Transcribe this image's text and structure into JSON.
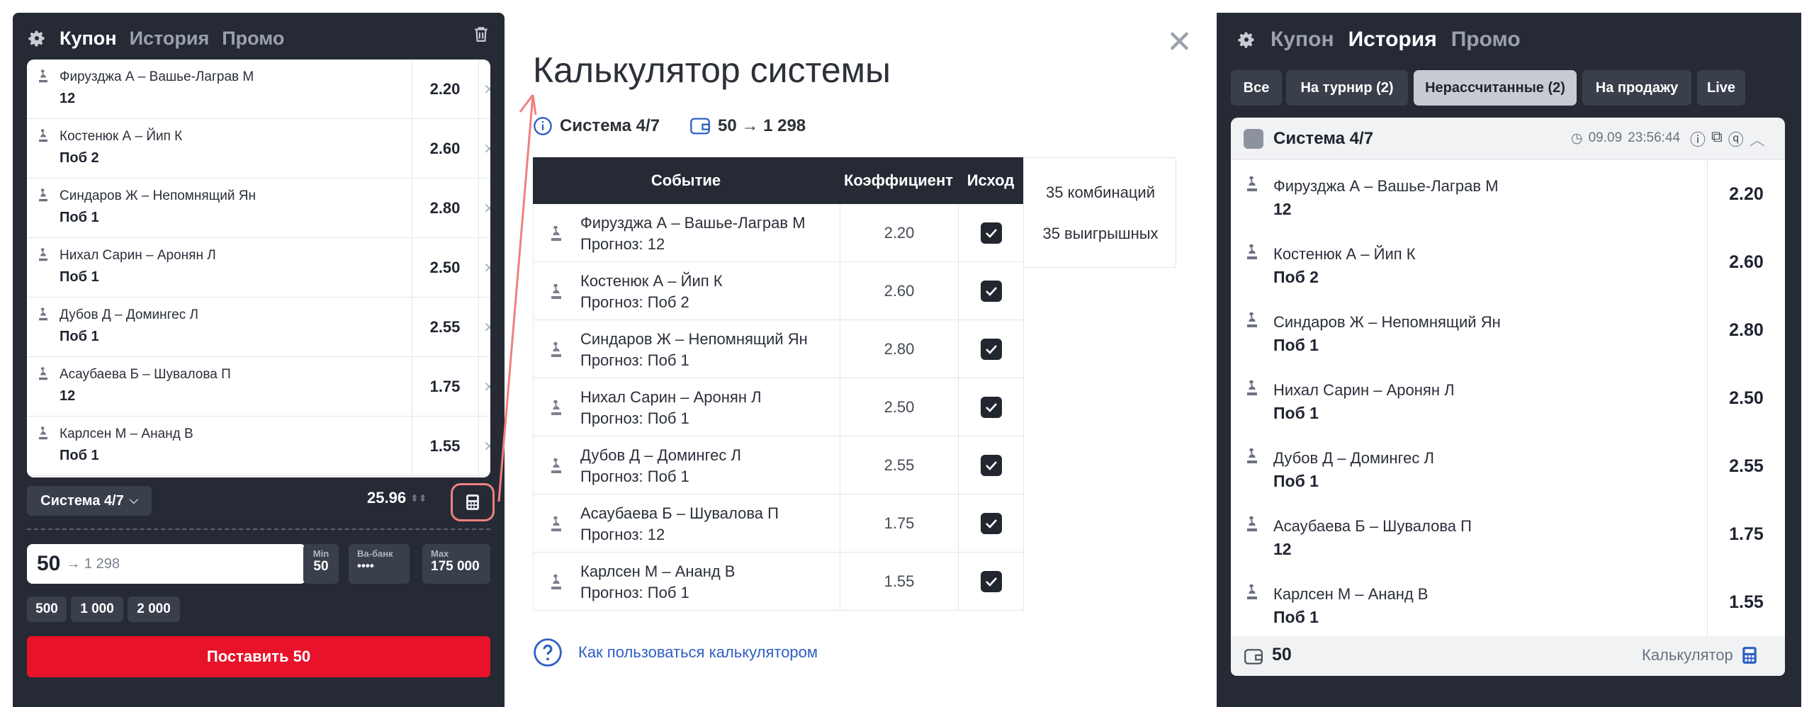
{
  "left": {
    "tabs": [
      "Купон",
      "История",
      "Промо"
    ],
    "events": [
      {
        "event": "Фирузджа А – Вашье-Лаграв М",
        "outcome": "12",
        "coef": "2.20"
      },
      {
        "event": "Костенюк А – Йип К",
        "outcome": "Поб 2",
        "coef": "2.60"
      },
      {
        "event": "Синдаров Ж – Непомнящий Ян",
        "outcome": "Поб 1",
        "coef": "2.80"
      },
      {
        "event": "Нихал Сарин – Аронян Л",
        "outcome": "Поб 1",
        "coef": "2.50"
      },
      {
        "event": "Дубов Д – Домингес Л",
        "outcome": "Поб 1",
        "coef": "2.55"
      },
      {
        "event": "Асаубаева Б – Шувалова П",
        "outcome": "12",
        "coef": "1.75"
      },
      {
        "event": "Карлсен М – Ананд В",
        "outcome": "Поб 1",
        "coef": "1.55"
      }
    ],
    "system_select": "Система 4/7",
    "total_coef": "25.96",
    "stake_value": "50",
    "stake_win": "→ 1 298",
    "min_label": "Min",
    "min_value": "50",
    "vabank_label": "Ва-банк",
    "vabank_value": "••••",
    "max_label": "Max",
    "max_value": "175 000",
    "quick": [
      "500",
      "1 000",
      "2 000"
    ],
    "place_button": "Поставить 50"
  },
  "middle": {
    "title": "Калькулятор системы",
    "system": "Система 4/7",
    "stake_info": "50 → 1 298",
    "headers": {
      "event": "Событие",
      "coef": "Коэффициент",
      "outcome": "Исход"
    },
    "prognoz_prefix": "Прогноз: ",
    "combinations": "35 комбинаций",
    "winning": "35 выигрышных",
    "help_link": "Как пользоваться калькулятором"
  },
  "right": {
    "tabs": [
      "Купон",
      "История",
      "Промо"
    ],
    "filters": [
      "Все",
      "На турнир (2)",
      "Нерассчитанные (2)",
      "На продажу",
      "Live"
    ],
    "bet_title": "Система 4/7",
    "bet_date": "09.09",
    "bet_time": "23:56:44",
    "stake": "50",
    "calculator_label": "Калькулятор"
  },
  "colors": {
    "dark_panel": "#262a35",
    "accent_red": "#e8132a",
    "annotation": "#f08080",
    "link_blue": "#2f5fc4"
  }
}
